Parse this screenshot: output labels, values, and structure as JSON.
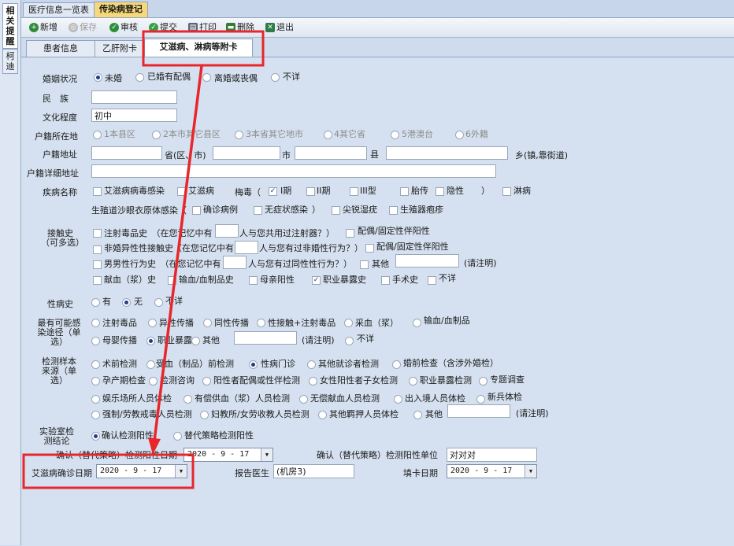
{
  "side_tabs": [
    "相关提醒",
    "柯迪"
  ],
  "top_tabs": [
    "医疗信息一览表",
    "传染病登记"
  ],
  "toolbar": {
    "new": "新增",
    "save": "保存",
    "audit": "审核",
    "submit": "提交",
    "print": "打印",
    "delete": "删除",
    "exit": "退出"
  },
  "sub_tabs": [
    "患者信息",
    "乙肝附卡",
    "艾滋病、淋病等附卡"
  ],
  "marriage": {
    "label": "婚姻状况",
    "options": [
      "未婚",
      "已婚有配偶",
      "离婚或丧偶",
      "不详"
    ],
    "selected": 0
  },
  "ethnicity": {
    "label": "民　族",
    "value": ""
  },
  "education": {
    "label": "文化程度",
    "value": "初中"
  },
  "residence": {
    "label": "户籍所在地",
    "options": [
      "1本县区",
      "2本市其它县区",
      "3本省其它地市",
      "4其它省",
      "5港澳台",
      "6外籍"
    ]
  },
  "address": {
    "label": "户籍地址",
    "province": "省(区、市)",
    "city": "市",
    "county": "县",
    "town": "乡(镇,靠街道)"
  },
  "address_detail": {
    "label": "户籍详细地址",
    "value": ""
  },
  "disease": {
    "label": "疾病名称",
    "row1": [
      "艾滋病病毒感染",
      "艾滋病"
    ],
    "syphilis_label": "梅毒（",
    "syphilis": [
      "I期",
      "II期",
      "III型",
      "胎传",
      "隐性"
    ],
    "syphilis_close": "）",
    "gonorrhea": "淋病",
    "row2_label": "生殖道沙眼衣原体感染（",
    "row2": [
      "确诊病例",
      "无症状感染"
    ],
    "row2_close": "）",
    "row2_extra": [
      "尖锐湿疣",
      "生殖器疱疹"
    ]
  },
  "contact": {
    "label": "接触史",
    "sublabel": "（可多选）",
    "r1a": "注射毒品史　（在您记忆中有",
    "r1b": "人与您共用过注射器？）",
    "r1c": "配偶/固定性伴阳性",
    "r2a": "非婚异性性接触史（在您记忆中有",
    "r2b": "人与您有过非婚性行为？）",
    "r2c": "配偶/固定性伴阳性",
    "r3a": "男男性行为史　（在您记忆中有",
    "r3b": "人与您有过同性性行为？）",
    "r3c": "其他",
    "r3d": "(请注明)",
    "r4": [
      "献血（浆）史",
      "输血/血制品史",
      "母亲阳性",
      "职业暴露史",
      "手术史",
      "不详"
    ]
  },
  "std_history": {
    "label": "性病史",
    "options": [
      "有",
      "无",
      "不详"
    ],
    "selected": 1
  },
  "route": {
    "label": "最有可能感染途径（单选）",
    "row1": [
      "注射毒品",
      "异性传播",
      "同性传播",
      "性接触+注射毒品",
      "采血（浆）",
      "输血/血制品"
    ],
    "row2": [
      "母婴传播",
      "职业暴露",
      "其他"
    ],
    "note": "(请注明)",
    "unknown": "不详"
  },
  "source": {
    "label": "检测样本来源（单选）",
    "row1": [
      "术前检测",
      "受血（制品）前检测",
      "性病门诊",
      "其他就诊者检测",
      "婚前检查（含涉外婚检）"
    ],
    "row2": [
      "孕产期检查",
      "检测咨询",
      "阳性者配偶或性伴检测",
      "女性阳性者子女检测",
      "职业暴露检测",
      "专题调查"
    ],
    "row3": [
      "娱乐场所人员体检",
      "有偿供血（浆）人员检测",
      "无偿献血人员检测",
      "出入境人员体检",
      "新兵体检"
    ],
    "row4": [
      "强制/劳教戒毒人员检测",
      "妇教所/女劳收教人员检测",
      "其他羁押人员体检",
      "其他"
    ],
    "note": "(请注明)"
  },
  "lab": {
    "label": "实验室检测结论",
    "options": [
      "确认检测阳性",
      "替代策略检测阳性"
    ],
    "selected": 0
  },
  "confirm_date": {
    "label": "确认（替代策略）检测阳性日期",
    "value": "2020 - 9 - 17"
  },
  "confirm_unit": {
    "label": "确认（替代策略）检测阳性单位",
    "value": "对对对"
  },
  "diagnosis_date": {
    "label": "艾滋病确诊日期",
    "value": "2020 - 9 - 17"
  },
  "doctor": {
    "label": "报告医生",
    "value": "(机房3)"
  },
  "fill_date": {
    "label": "填卡日期",
    "value": "2020 - 9 - 17"
  },
  "colors": {
    "annotation": "#e8262b",
    "active_tab": "#f6d87a",
    "panel": "#d5e1f0"
  }
}
